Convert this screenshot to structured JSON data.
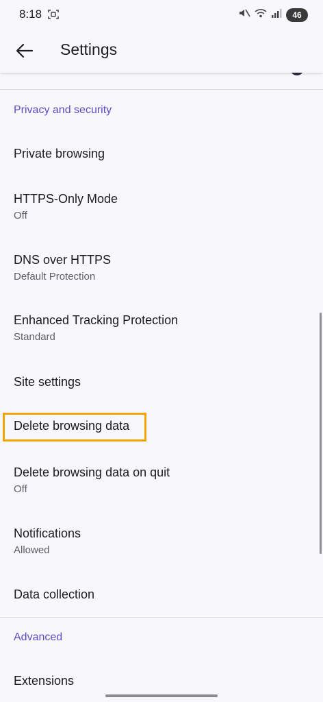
{
  "status_bar": {
    "time": "8:18",
    "battery": "46"
  },
  "app_bar": {
    "title": "Settings"
  },
  "sections": {
    "privacy_header": "Privacy and security",
    "advanced_header": "Advanced"
  },
  "items": {
    "private_browsing": {
      "title": "Private browsing"
    },
    "https_only": {
      "title": "HTTPS-Only Mode",
      "subtitle": "Off"
    },
    "dns_https": {
      "title": "DNS over HTTPS",
      "subtitle": "Default Protection"
    },
    "etp": {
      "title": "Enhanced Tracking Protection",
      "subtitle": "Standard"
    },
    "site_settings": {
      "title": "Site settings"
    },
    "delete_data": {
      "title": "Delete browsing data"
    },
    "delete_on_quit": {
      "title": "Delete browsing data on quit",
      "subtitle": "Off"
    },
    "notifications": {
      "title": "Notifications",
      "subtitle": "Allowed"
    },
    "data_collection": {
      "title": "Data collection"
    },
    "extensions": {
      "title": "Extensions"
    }
  },
  "colors": {
    "accent": "#5B4CC4",
    "highlight": "#F5A300",
    "background": "#F8F7FB"
  }
}
